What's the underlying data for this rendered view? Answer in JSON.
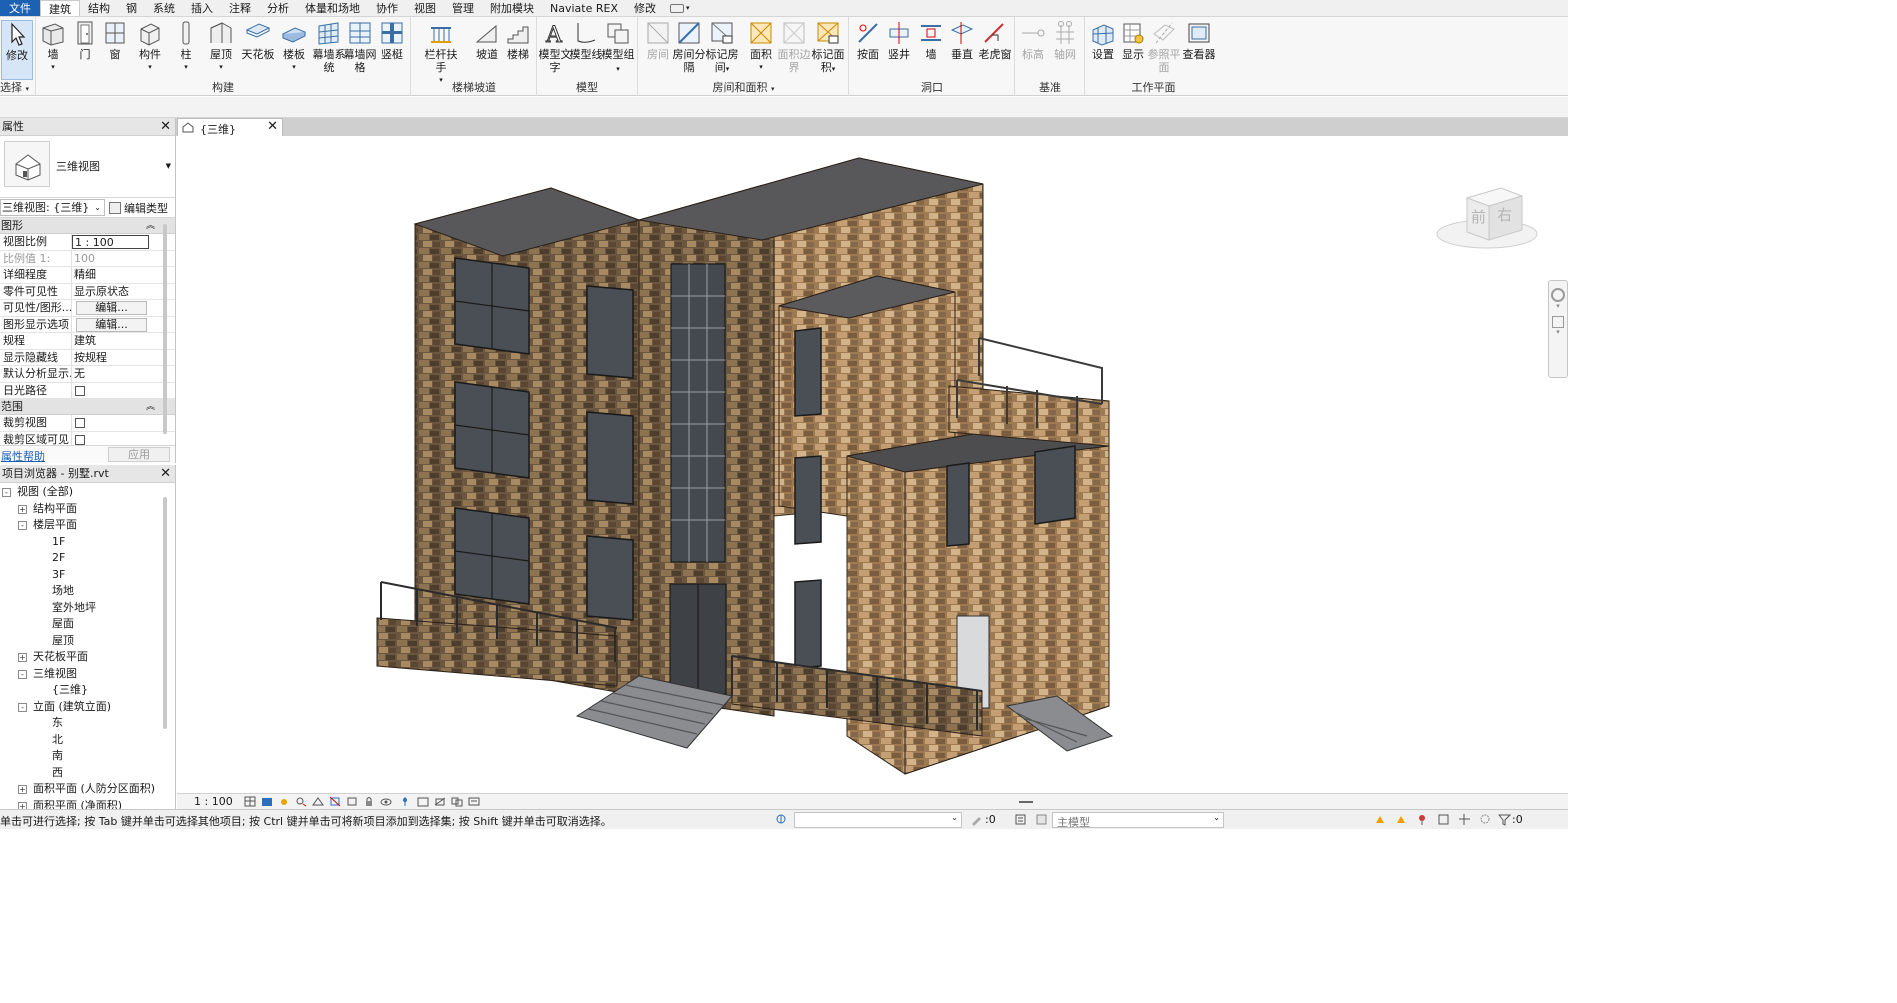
{
  "menu": {
    "tabs": [
      "文件",
      "建筑",
      "结构",
      "钢",
      "系统",
      "插入",
      "注释",
      "分析",
      "体量和场地",
      "协作",
      "视图",
      "管理",
      "附加模块",
      "Naviate REX",
      "修改"
    ],
    "active": "建筑"
  },
  "ribbon": {
    "select": {
      "modify": "修改",
      "select_menu": "选择"
    },
    "build": {
      "title": "构建",
      "tools": [
        "墙",
        "门",
        "窗",
        "构件",
        "柱",
        "屋顶",
        "天花板",
        "楼板",
        "幕墙系统",
        "幕墙网格",
        "竖梃"
      ]
    },
    "circulation": {
      "title": "楼梯坡道",
      "tools": [
        "栏杆扶手",
        "坡道",
        "楼梯"
      ]
    },
    "model": {
      "title": "模型",
      "tools": [
        "模型文字",
        "模型线",
        "模型组"
      ]
    },
    "room_area": {
      "title": "房间和面积",
      "tools": [
        "房间",
        "房间分隔",
        "标记房间",
        "面积",
        "面积边界",
        "标记面积"
      ]
    },
    "opening": {
      "title": "洞口",
      "tools": [
        "按面",
        "竖井",
        "墙",
        "垂直",
        "老虎窗"
      ]
    },
    "datum": {
      "title": "基准",
      "tools": [
        "标高",
        "轴网"
      ]
    },
    "workplane": {
      "title": "工作平面",
      "tools": [
        "设置",
        "显示",
        "参照平面",
        "查看器"
      ]
    }
  },
  "properties": {
    "title": "属性",
    "type_name": "三维视图",
    "instance_selector": "三维视图: {三维}",
    "edit_type": "编辑类型",
    "groups": [
      {
        "name": "图形",
        "rows": [
          {
            "k": "视图比例",
            "v": "1 : 100"
          },
          {
            "k": "比例值 1:",
            "v": "100"
          },
          {
            "k": "详细程度",
            "v": "精细"
          },
          {
            "k": "零件可见性",
            "v": "显示原状态"
          },
          {
            "k": "可见性/图形...",
            "v": "编辑..."
          },
          {
            "k": "图形显示选项",
            "v": "编辑..."
          },
          {
            "k": "规程",
            "v": "建筑"
          },
          {
            "k": "显示隐藏线",
            "v": "按规程"
          },
          {
            "k": "默认分析显示...",
            "v": "无"
          },
          {
            "k": "日光路径",
            "v": ""
          }
        ]
      },
      {
        "name": "范围",
        "rows": [
          {
            "k": "裁剪视图",
            "v": ""
          },
          {
            "k": "裁剪区域可见",
            "v": ""
          }
        ]
      }
    ],
    "help_link": "属性帮助",
    "apply": "应用"
  },
  "browser": {
    "title": "项目浏览器 - 别墅.rvt",
    "nodes": [
      {
        "label": "视图 (全部)",
        "depth": 0,
        "toggle": "-"
      },
      {
        "label": "结构平面",
        "depth": 1,
        "toggle": "+"
      },
      {
        "label": "楼层平面",
        "depth": 1,
        "toggle": "-"
      },
      {
        "label": "1F",
        "depth": 2,
        "toggle": ""
      },
      {
        "label": "2F",
        "depth": 2,
        "toggle": ""
      },
      {
        "label": "3F",
        "depth": 2,
        "toggle": ""
      },
      {
        "label": "场地",
        "depth": 2,
        "toggle": ""
      },
      {
        "label": "室外地坪",
        "depth": 2,
        "toggle": ""
      },
      {
        "label": "屋面",
        "depth": 2,
        "toggle": ""
      },
      {
        "label": "屋顶",
        "depth": 2,
        "toggle": ""
      },
      {
        "label": "天花板平面",
        "depth": 1,
        "toggle": "+"
      },
      {
        "label": "三维视图",
        "depth": 1,
        "toggle": "-"
      },
      {
        "label": "{三维}",
        "depth": 2,
        "toggle": ""
      },
      {
        "label": "立面 (建筑立面)",
        "depth": 1,
        "toggle": "-"
      },
      {
        "label": "东",
        "depth": 2,
        "toggle": ""
      },
      {
        "label": "北",
        "depth": 2,
        "toggle": ""
      },
      {
        "label": "南",
        "depth": 2,
        "toggle": ""
      },
      {
        "label": "西",
        "depth": 2,
        "toggle": ""
      },
      {
        "label": "面积平面 (人防分区面积)",
        "depth": 1,
        "toggle": "+"
      },
      {
        "label": "面积平面 (净面积)",
        "depth": 1,
        "toggle": "+"
      }
    ]
  },
  "view": {
    "tab_label": "{三维}",
    "viewcube": {
      "front": "前",
      "right": "右"
    }
  },
  "view_control": {
    "scale": "1 : 100"
  },
  "status": {
    "message": "单击可进行选择; 按 Tab 键并单击可选择其他项目; 按 Ctrl 键并单击可将新项目添加到选择集; 按 Shift 键并单击可取消选择。",
    "selection_count": ":0",
    "main_model": "主模型",
    "filter_count": ":0"
  }
}
